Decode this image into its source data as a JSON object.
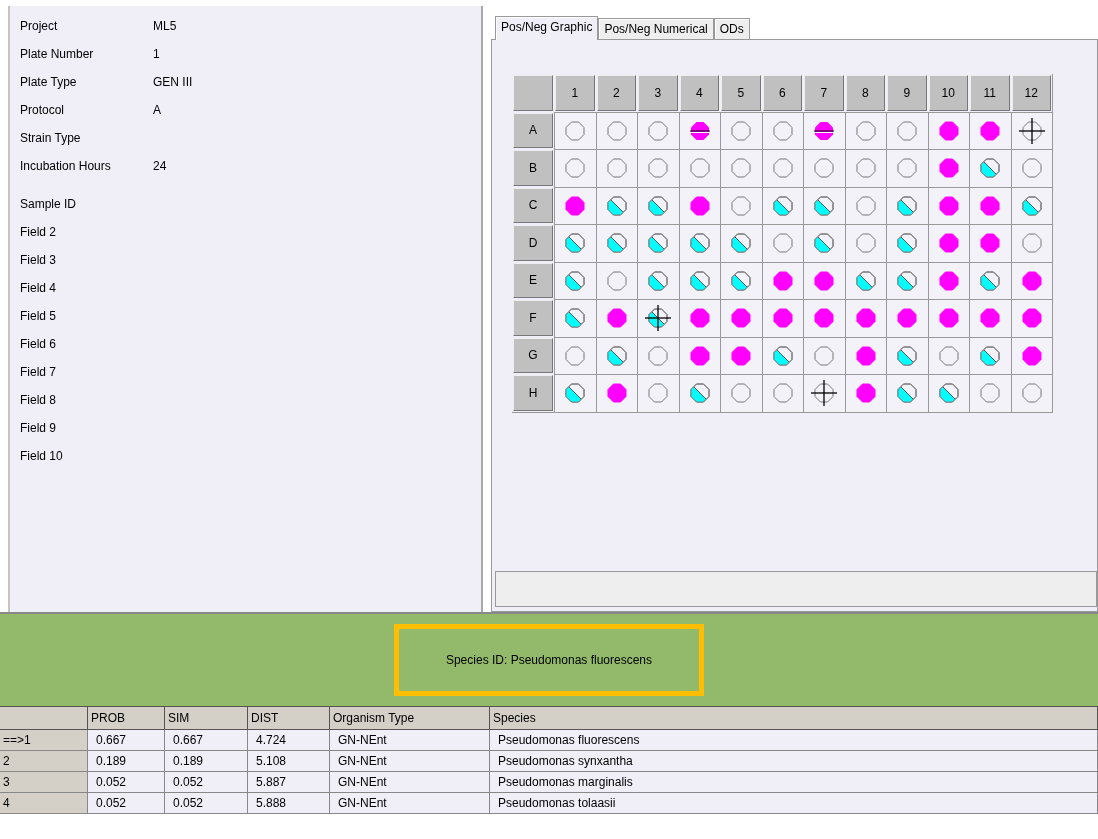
{
  "info": {
    "fields": [
      {
        "label": "Project",
        "value": "ML5"
      },
      {
        "label": "Plate Number",
        "value": "1"
      },
      {
        "label": "Plate Type",
        "value": "GEN III"
      },
      {
        "label": "Protocol",
        "value": "A"
      },
      {
        "label": "Strain Type"
      },
      {
        "label": "Incubation Hours",
        "value": "24"
      }
    ],
    "sample_fields": [
      "Sample ID",
      "Field 2",
      "Field 3",
      "Field 4",
      "Field 5",
      "Field 6",
      "Field 7",
      "Field 8",
      "Field 9",
      "Field 10"
    ]
  },
  "tabs": [
    {
      "label": "Pos/Neg Graphic",
      "selected": true
    },
    {
      "label": "Pos/Neg Numerical",
      "selected": false
    },
    {
      "label": "ODs",
      "selected": false
    }
  ],
  "plate": {
    "columns": [
      "1",
      "2",
      "3",
      "4",
      "5",
      "6",
      "7",
      "8",
      "9",
      "10",
      "11",
      "12"
    ],
    "rows": [
      {
        "label": "A",
        "wells": [
          {
            "kind": "neg",
            "marked": false
          },
          {
            "kind": "neg",
            "marked": false
          },
          {
            "kind": "neg",
            "marked": false
          },
          {
            "kind": "weak",
            "marked": false
          },
          {
            "kind": "neg",
            "marked": false
          },
          {
            "kind": "neg",
            "marked": false
          },
          {
            "kind": "weak",
            "marked": false
          },
          {
            "kind": "neg",
            "marked": false
          },
          {
            "kind": "neg",
            "marked": false
          },
          {
            "kind": "pos",
            "marked": false
          },
          {
            "kind": "pos",
            "marked": false
          },
          {
            "kind": "neg",
            "marked": true
          }
        ]
      },
      {
        "label": "B",
        "wells": [
          {
            "kind": "neg",
            "marked": false
          },
          {
            "kind": "neg",
            "marked": false
          },
          {
            "kind": "neg",
            "marked": false
          },
          {
            "kind": "neg",
            "marked": false
          },
          {
            "kind": "neg",
            "marked": false
          },
          {
            "kind": "neg",
            "marked": false
          },
          {
            "kind": "neg",
            "marked": false
          },
          {
            "kind": "neg",
            "marked": false
          },
          {
            "kind": "neg",
            "marked": false
          },
          {
            "kind": "pos",
            "marked": false
          },
          {
            "kind": "borderline",
            "marked": false
          },
          {
            "kind": "neg",
            "marked": false
          }
        ]
      },
      {
        "label": "C",
        "wells": [
          {
            "kind": "pos",
            "marked": false
          },
          {
            "kind": "borderline",
            "marked": false
          },
          {
            "kind": "borderline",
            "marked": false
          },
          {
            "kind": "pos",
            "marked": false
          },
          {
            "kind": "neg",
            "marked": false
          },
          {
            "kind": "borderline",
            "marked": false
          },
          {
            "kind": "borderline",
            "marked": false
          },
          {
            "kind": "neg",
            "marked": false
          },
          {
            "kind": "borderline",
            "marked": false
          },
          {
            "kind": "pos",
            "marked": false
          },
          {
            "kind": "pos",
            "marked": false
          },
          {
            "kind": "borderline",
            "marked": false
          }
        ]
      },
      {
        "label": "D",
        "wells": [
          {
            "kind": "borderline",
            "marked": false
          },
          {
            "kind": "borderline",
            "marked": false
          },
          {
            "kind": "borderline",
            "marked": false
          },
          {
            "kind": "borderline",
            "marked": false
          },
          {
            "kind": "borderline",
            "marked": false
          },
          {
            "kind": "neg",
            "marked": false
          },
          {
            "kind": "borderline",
            "marked": false
          },
          {
            "kind": "neg",
            "marked": false
          },
          {
            "kind": "borderline",
            "marked": false
          },
          {
            "kind": "pos",
            "marked": false
          },
          {
            "kind": "pos",
            "marked": false
          },
          {
            "kind": "neg",
            "marked": false
          }
        ]
      },
      {
        "label": "E",
        "wells": [
          {
            "kind": "borderline",
            "marked": false
          },
          {
            "kind": "neg",
            "marked": false
          },
          {
            "kind": "borderline",
            "marked": false
          },
          {
            "kind": "borderline",
            "marked": false
          },
          {
            "kind": "borderline",
            "marked": false
          },
          {
            "kind": "pos",
            "marked": false
          },
          {
            "kind": "pos",
            "marked": false
          },
          {
            "kind": "borderline",
            "marked": false
          },
          {
            "kind": "borderline",
            "marked": false
          },
          {
            "kind": "pos",
            "marked": false
          },
          {
            "kind": "borderline",
            "marked": false
          },
          {
            "kind": "pos",
            "marked": false
          }
        ]
      },
      {
        "label": "F",
        "wells": [
          {
            "kind": "borderline",
            "marked": false
          },
          {
            "kind": "pos",
            "marked": false
          },
          {
            "kind": "borderline",
            "marked": true
          },
          {
            "kind": "pos",
            "marked": false
          },
          {
            "kind": "pos",
            "marked": false
          },
          {
            "kind": "pos",
            "marked": false
          },
          {
            "kind": "pos",
            "marked": false
          },
          {
            "kind": "pos",
            "marked": false
          },
          {
            "kind": "pos",
            "marked": false
          },
          {
            "kind": "pos",
            "marked": false
          },
          {
            "kind": "pos",
            "marked": false
          },
          {
            "kind": "pos",
            "marked": false
          }
        ]
      },
      {
        "label": "G",
        "wells": [
          {
            "kind": "neg",
            "marked": false
          },
          {
            "kind": "borderline",
            "marked": false
          },
          {
            "kind": "neg",
            "marked": false
          },
          {
            "kind": "pos",
            "marked": false
          },
          {
            "kind": "pos",
            "marked": false
          },
          {
            "kind": "borderline",
            "marked": false
          },
          {
            "kind": "neg",
            "marked": false
          },
          {
            "kind": "pos",
            "marked": false
          },
          {
            "kind": "borderline",
            "marked": false
          },
          {
            "kind": "neg",
            "marked": false
          },
          {
            "kind": "borderline",
            "marked": false
          },
          {
            "kind": "pos",
            "marked": false
          }
        ]
      },
      {
        "label": "H",
        "wells": [
          {
            "kind": "borderline",
            "marked": false
          },
          {
            "kind": "pos",
            "marked": false
          },
          {
            "kind": "neg",
            "marked": false
          },
          {
            "kind": "borderline",
            "marked": false
          },
          {
            "kind": "neg",
            "marked": false
          },
          {
            "kind": "neg",
            "marked": false
          },
          {
            "kind": "neg",
            "marked": true
          },
          {
            "kind": "pos",
            "marked": false
          },
          {
            "kind": "borderline",
            "marked": false
          },
          {
            "kind": "borderline",
            "marked": false
          },
          {
            "kind": "neg",
            "marked": false
          },
          {
            "kind": "neg",
            "marked": false
          }
        ]
      }
    ]
  },
  "result": {
    "species_id": "Species ID: Pseudomonas fluorescens"
  },
  "table": {
    "columns": [
      "PROB",
      "SIM",
      "DIST",
      "Organism Type",
      "Species"
    ],
    "rows": [
      {
        "rank": "==>1",
        "cells": [
          "0.667",
          "0.667",
          "4.724",
          "GN-NEnt",
          "Pseudomonas fluorescens"
        ]
      },
      {
        "rank": "2",
        "cells": [
          "0.189",
          "0.189",
          "5.108",
          "GN-NEnt",
          "Pseudomonas synxantha"
        ]
      },
      {
        "rank": "3",
        "cells": [
          "0.052",
          "0.052",
          "5.887",
          "GN-NEnt",
          "Pseudomonas marginalis"
        ]
      },
      {
        "rank": "4",
        "cells": [
          "0.052",
          "0.052",
          "5.888",
          "GN-NEnt",
          "Pseudomonas tolaasii"
        ]
      }
    ]
  }
}
